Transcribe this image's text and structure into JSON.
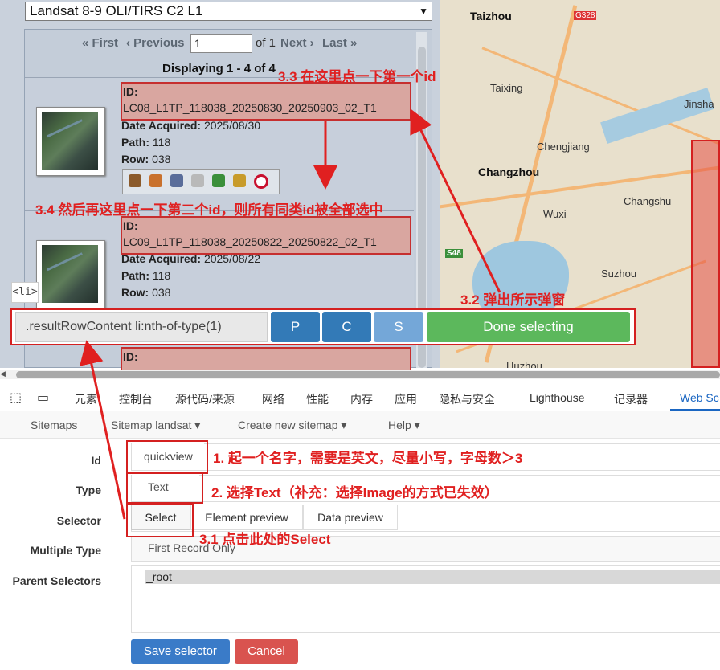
{
  "dataset": {
    "selected": "Landsat 8-9 OLI/TIRS C2 L1"
  },
  "pager": {
    "first": "« First",
    "previous": "‹ Previous",
    "page_value": "1",
    "of_label": "of 1",
    "next": "Next ›",
    "last": "Last »",
    "displaying": "Displaying 1 - 4 of 4"
  },
  "results": [
    {
      "id_label": "ID:",
      "id": "LC08_L1TP_118038_20250830_20250903_02_T1",
      "date_label": "Date Acquired:",
      "date": "2025/08/30",
      "path_label": "Path:",
      "path": "118",
      "row_label": "Row:",
      "row": "038"
    },
    {
      "id_label": "ID:",
      "id": "LC09_L1TP_118038_20250822_20250822_02_T1",
      "date_label": "Date Acquired:",
      "date": "2025/08/22",
      "path_label": "Path:",
      "path": "118",
      "row_label": "Row:",
      "row": "038"
    },
    {
      "id_label": "ID:"
    }
  ],
  "map": {
    "cities": [
      "Taizhou",
      "Taixing",
      "Jinsha",
      "Changzhou",
      "Chengjiang",
      "Changshu",
      "Wuxi",
      "Suzhou",
      "Huzhou"
    ],
    "road_shields": [
      "G328",
      "S48"
    ]
  },
  "selector_bar": {
    "li_tag": "<li>",
    "selector_text": ".resultRowContent li:nth-of-type(1)",
    "p": "P",
    "c": "C",
    "s": "S",
    "done": "Done selecting"
  },
  "devtools_tabs": [
    "元素",
    "控制台",
    "源代码/来源",
    "网络",
    "性能",
    "内存",
    "应用",
    "隐私与安全",
    "Lighthouse",
    "记录器",
    "Web Sc"
  ],
  "sitemap_nav": [
    "Sitemaps",
    "Sitemap landsat ▾",
    "Create new sitemap ▾",
    "Help ▾"
  ],
  "form": {
    "id_label": "Id",
    "id_value": "quickview",
    "type_label": "Type",
    "type_value": "Text",
    "selector_label": "Selector",
    "select_btn": "Select",
    "element_preview": "Element preview",
    "data_preview": "Data preview",
    "multiple_label": "Multiple Type",
    "multiple_value": "First Record Only",
    "parent_label": "Parent Selectors",
    "parent_value": "_root",
    "save": "Save selector",
    "cancel": "Cancel"
  },
  "annotations": {
    "a33": "3.3 在这里点一下第一个id",
    "a34": "3.4 然后再这里点一下第二个id，则所有同类id被全部选中",
    "a32": "3.2 弹出所示弹窗",
    "a1": "1. 起一个名字，需要是英文，尽量小写，字母数＞3",
    "a2": "2. 选择Text（补充：选择Image的方式已失效）",
    "a31": "3.1 点击此处的Select"
  },
  "colors": {
    "annotation_red": "#e02020",
    "done_green": "#5cb85c",
    "button_blue": "#337ab7",
    "s_button": "#74a7d8"
  }
}
